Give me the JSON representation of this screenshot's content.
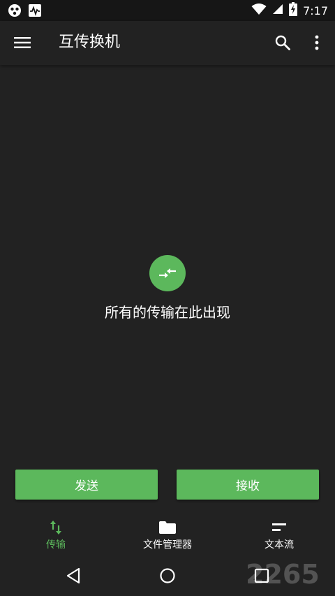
{
  "colors": {
    "accent": "#5cb85c",
    "background": "#222222",
    "status_bar": "#161616",
    "text": "#ffffff"
  },
  "status_bar": {
    "time": "7:17",
    "icons": [
      "notification-app-icon",
      "pulse-monitor-icon",
      "wifi-icon",
      "signal-icon",
      "battery-charging-icon"
    ]
  },
  "app_bar": {
    "title": "互传换机",
    "icons": [
      "menu-icon",
      "search-icon",
      "more-vert-icon"
    ]
  },
  "empty_state": {
    "icon": "transfer-arrows-icon",
    "message": "所有的传输在此出现"
  },
  "actions": {
    "send_label": "发送",
    "receive_label": "接收"
  },
  "bottom_nav": {
    "items": [
      {
        "label": "传输",
        "icon": "swap-vert-icon",
        "active": true
      },
      {
        "label": "文件管理器",
        "icon": "folder-icon",
        "active": false
      },
      {
        "label": "文本流",
        "icon": "short-text-icon",
        "active": false
      }
    ]
  },
  "system_nav": {
    "icons": [
      "back-icon",
      "home-icon",
      "recents-icon"
    ]
  }
}
